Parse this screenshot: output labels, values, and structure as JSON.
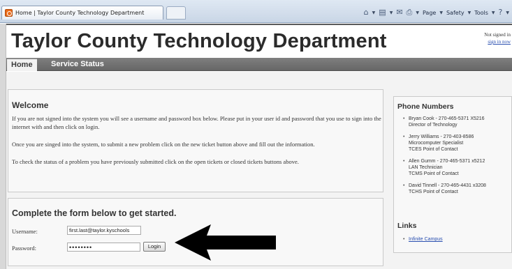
{
  "browser": {
    "tab_title": "Home | Taylor County Technology Department",
    "commands": {
      "page_label": "Page",
      "safety_label": "Safety",
      "tools_label": "Tools"
    }
  },
  "header": {
    "title": "Taylor County Technology Department",
    "signin_status": "Not signed in",
    "signin_link": "sign in now"
  },
  "nav": {
    "items": [
      {
        "label": "Home"
      },
      {
        "label": "Service Status"
      }
    ]
  },
  "welcome": {
    "heading": "Welcome",
    "paragraphs": [
      "If you are not signed into the system you will see a username and password box below. Please put in your user id and password that you use to sign into the internet with and then click on login.",
      "Once you are singed into the system, to submit a new problem click on the new ticket button above and fill out the information.",
      "To check the status of a problem you have previously submitted click on the open tickets or closed tickets buttons above."
    ]
  },
  "form": {
    "heading": "Complete the form below to get started.",
    "username_label": "Username:",
    "username_value": "first.last@taylor.kyschools",
    "password_label": "Password:",
    "password_value": "••••••••",
    "login_label": "Login"
  },
  "phone": {
    "heading": "Phone Numbers",
    "contacts": [
      {
        "line1": "Bryan Cook - 270-465-5371 X5216",
        "line2": "Director of Technology",
        "line3": ""
      },
      {
        "line1": "Jerry Williams - 270-403-8586",
        "line2": "Microcomputer Specialist",
        "line3": "TCES Point of Contact"
      },
      {
        "line1": "Allen Gumm - 270-465-5371 x5212",
        "line2": "LAN Technician",
        "line3": "TCMS Point of Contact"
      },
      {
        "line1": "David Tinnell - 270-465-4431 x3208",
        "line2": "TCHS Point of Contact",
        "line3": ""
      }
    ]
  },
  "links": {
    "heading": "Links",
    "items": [
      {
        "label": "Infinite Campus"
      }
    ]
  }
}
